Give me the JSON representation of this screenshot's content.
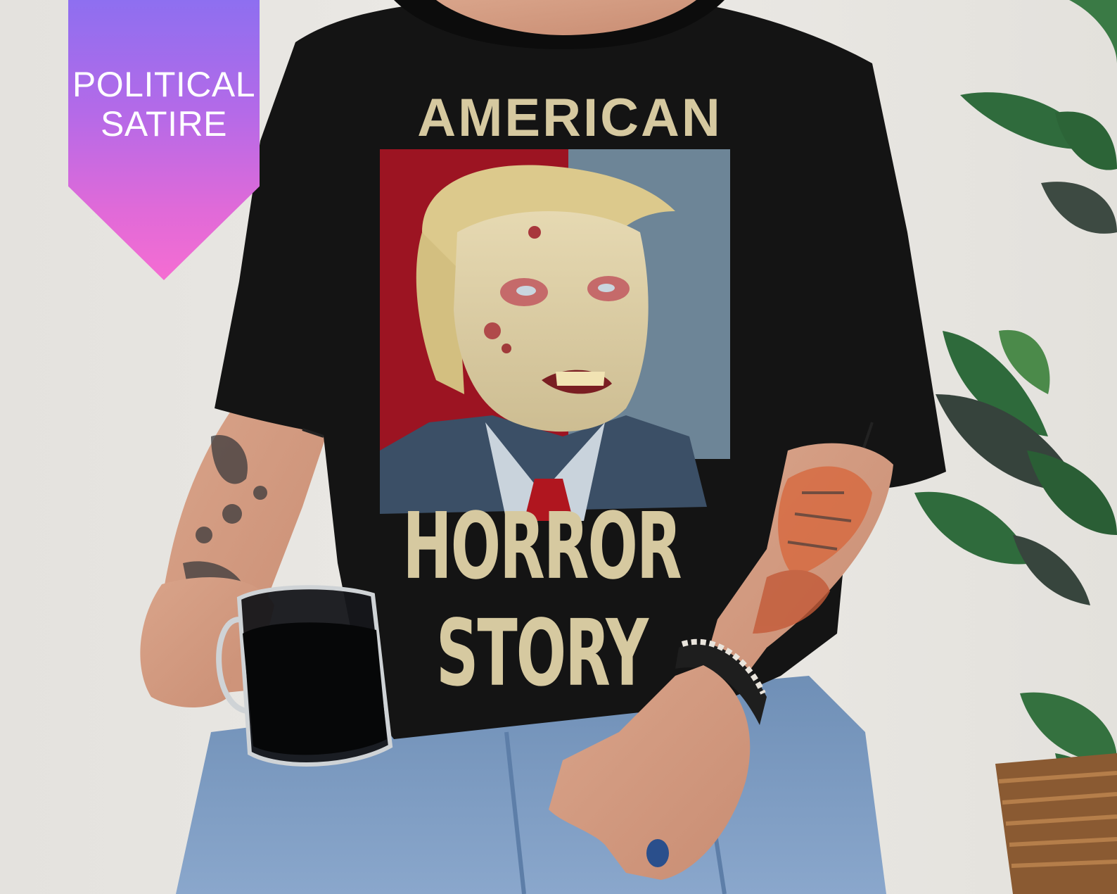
{
  "banner": {
    "line1": "POLITICAL",
    "line2": "SATIRE",
    "colors": {
      "top": "#8e6ff0",
      "bottom": "#f56dd2"
    }
  },
  "shirt": {
    "title": "AMERICAN",
    "subtitle": "HORROR STORY",
    "text_color": "#d6c9a0",
    "shirt_color": "#141414",
    "print_colors": {
      "left_panel": "#9c1422",
      "right_panel": "#6d8597"
    }
  }
}
